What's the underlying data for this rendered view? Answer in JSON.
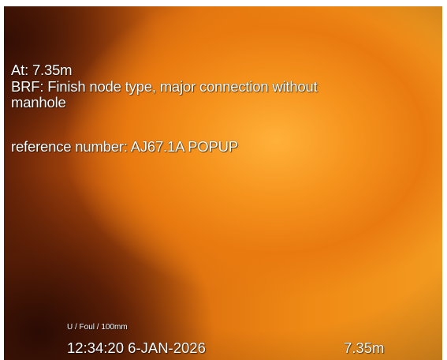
{
  "overlay": {
    "position_line": "At: 7.35m",
    "brf_line_1": "BRF: Finish node type, major connection without",
    "brf_line_2": "manhole",
    "reference_line": "reference number: AJ67.1A POPUP",
    "pipe_info": "U / Foul / 100mm",
    "timestamp": "12:34:20 6-JAN-2026",
    "distance": "7.35m"
  },
  "colors": {
    "text": "#ffffff",
    "feed_bright": "#ffb13a",
    "feed_mid": "#e97a10",
    "feed_dark": "#2e0c04"
  }
}
